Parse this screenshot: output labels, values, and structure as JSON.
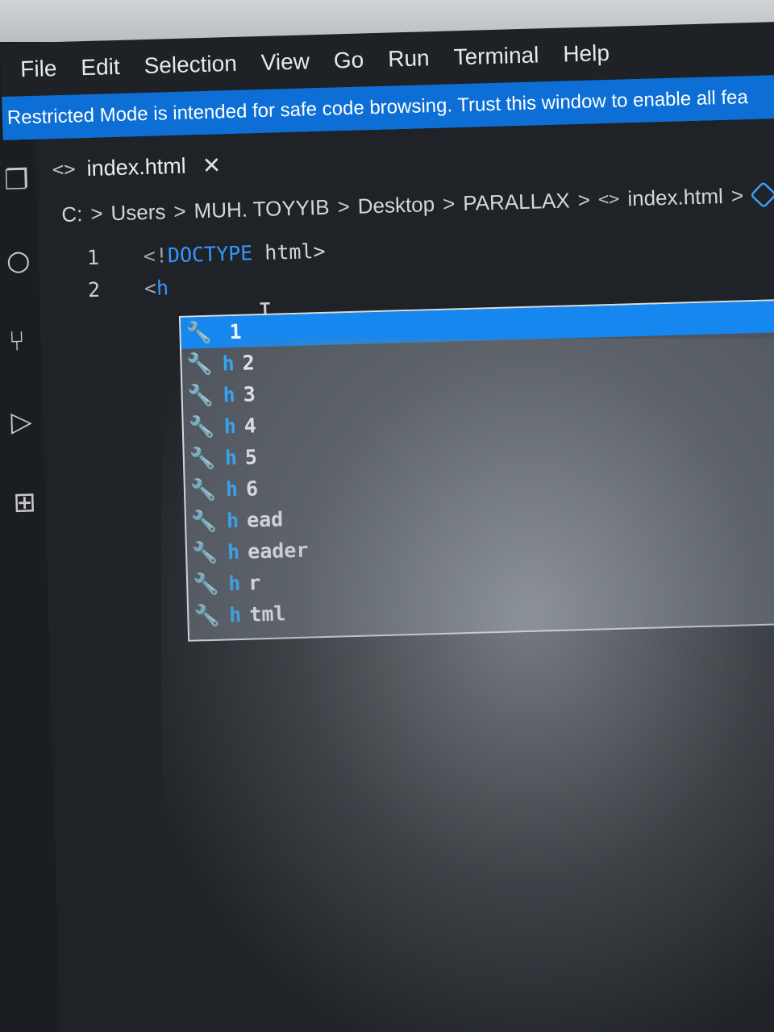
{
  "menubar": {
    "items": [
      "File",
      "Edit",
      "Selection",
      "View",
      "Go",
      "Run",
      "Terminal",
      "Help"
    ]
  },
  "banner": {
    "text": "Restricted Mode is intended for safe code browsing. Trust this window to enable all fea"
  },
  "tab": {
    "title": "index.html",
    "close": "✕"
  },
  "breadcrumb": {
    "items": [
      "C:",
      "Users",
      "MUH. TOYYIB",
      "Desktop",
      "PARALLAX",
      "index.html"
    ]
  },
  "code": {
    "lines": [
      {
        "num": "1",
        "punct_open": "<!",
        "keyword": "DOCTYPE",
        "rest": " html>"
      },
      {
        "num": "2",
        "punct_open": "<",
        "keyword": "h",
        "rest": ""
      }
    ]
  },
  "suggestions": [
    {
      "match": "",
      "rest": "1",
      "selected": true
    },
    {
      "match": "h",
      "rest": "2",
      "selected": false
    },
    {
      "match": "h",
      "rest": "3",
      "selected": false
    },
    {
      "match": "h",
      "rest": "4",
      "selected": false
    },
    {
      "match": "h",
      "rest": "5",
      "selected": false
    },
    {
      "match": "h",
      "rest": "6",
      "selected": false
    },
    {
      "match": "h",
      "rest": "ead",
      "selected": false
    },
    {
      "match": "h",
      "rest": "eader",
      "selected": false
    },
    {
      "match": "h",
      "rest": "r",
      "selected": false
    },
    {
      "match": "h",
      "rest": "tml",
      "selected": false
    }
  ],
  "colors": {
    "banner": "#0d6fd6",
    "selected_suggestion": "#1587ee",
    "keyword": "#3794ff"
  }
}
